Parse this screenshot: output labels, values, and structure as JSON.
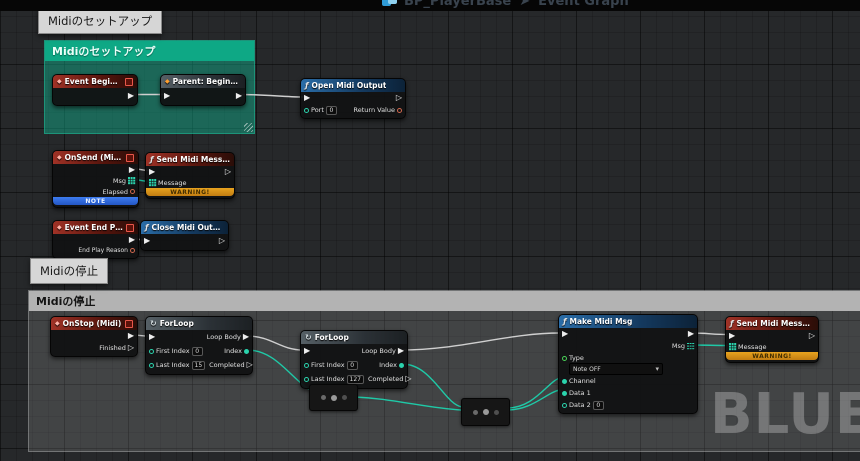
{
  "topbar": {
    "breadcrumb_root": "BP_PlayerBase",
    "breadcrumb_separator": "➤",
    "breadcrumb_page": "Event Graph"
  },
  "icons": {
    "function": "ƒ",
    "event": "◆",
    "parent": "◆",
    "loop": "↻",
    "caret": "▾",
    "exec_filled": "▶",
    "exec_hollow": "▷"
  },
  "tooltips": {
    "setup": "Midiのセットアップ",
    "stop": "Midiの停止"
  },
  "comments": {
    "setup_title": "Midiのセットアップ",
    "stop_title": "Midiの停止"
  },
  "watermark": "BLUEP",
  "nodes": {
    "event_begin_play": {
      "title": "Event BeginPlay"
    },
    "parent_begin_play": {
      "title": "Parent: BeginPlay"
    },
    "open_midi_output": {
      "title": "Open Midi Output",
      "port_label": "Port",
      "port_value": "0",
      "return_label": "Return Value"
    },
    "on_send": {
      "title": "OnSend (Midi)",
      "msg_label": "Msg",
      "elapsed_label": "Elapsed",
      "note_label": "NOTE"
    },
    "send_midi_message_1": {
      "title": "Send Midi Message",
      "message_label": "Message",
      "warning_label": "WARNING!"
    },
    "event_end_play": {
      "title": "Event End Play",
      "reason_label": "End Play Reason"
    },
    "close_midi_output": {
      "title": "Close Midi Output"
    },
    "on_stop": {
      "title": "OnStop (Midi)",
      "finished_label": "Finished"
    },
    "for_loop_1": {
      "title": "ForLoop",
      "first_index_label": "First Index",
      "first_index_value": "0",
      "last_index_label": "Last Index",
      "last_index_value": "15",
      "loop_body_label": "Loop Body",
      "index_label": "Index",
      "completed_label": "Completed"
    },
    "for_loop_2": {
      "title": "ForLoop",
      "first_index_label": "First Index",
      "first_index_value": "0",
      "last_index_label": "Last Index",
      "last_index_value": "127",
      "loop_body_label": "Loop Body",
      "index_label": "Index",
      "completed_label": "Completed"
    },
    "make_midi_msg": {
      "title": "Make Midi Msg",
      "type_label": "Type",
      "type_value": "Note OFF",
      "channel_label": "Channel",
      "data1_label": "Data 1",
      "data2_label": "Data 2",
      "data2_value": "0",
      "msg_label": "Msg"
    },
    "send_midi_message_2": {
      "title": "Send Midi Message",
      "message_label": "Message",
      "warning_label": "WARNING!"
    }
  }
}
